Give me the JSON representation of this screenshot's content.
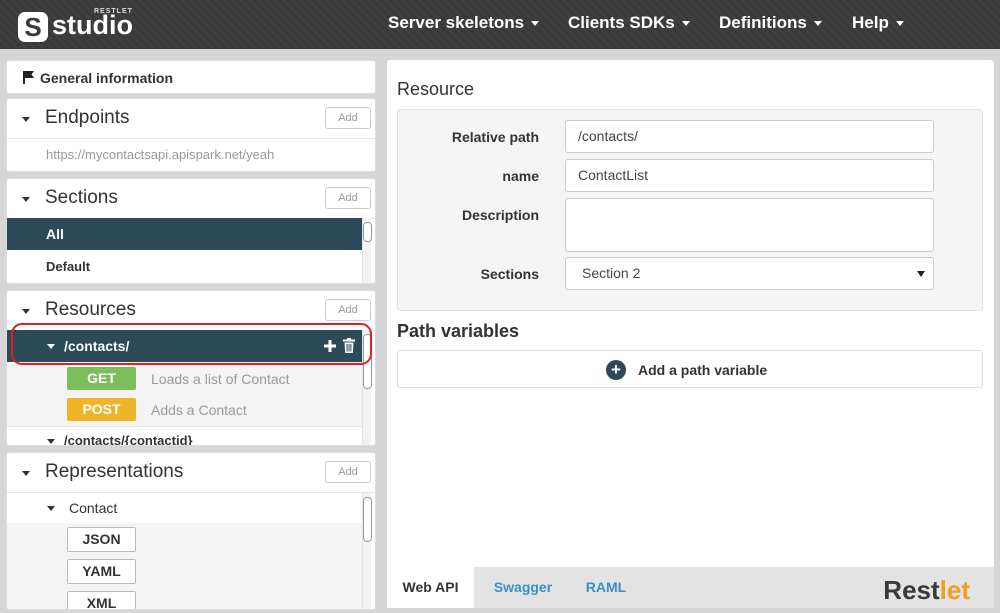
{
  "header": {
    "logo_small": "RESTLET",
    "logo_text": "studio",
    "nav": [
      {
        "label": "Server skeletons"
      },
      {
        "label": "Clients SDKs"
      },
      {
        "label": "Definitions"
      },
      {
        "label": "Help"
      }
    ]
  },
  "sidebar": {
    "general": {
      "label": "General information",
      "icon": "flag-icon"
    },
    "endpoints": {
      "title": "Endpoints",
      "add_label": "Add",
      "url": "https://mycontactsapi.apispark.net/yeah"
    },
    "sections": {
      "title": "Sections",
      "add_label": "Add",
      "items": [
        {
          "label": "All"
        },
        {
          "label": "Default"
        }
      ]
    },
    "resources": {
      "title": "Resources",
      "add_label": "Add",
      "items": [
        {
          "path": "/contacts/",
          "methods": [
            {
              "verb": "GET",
              "description": "Loads a list of Contact",
              "color": "#7cbf5a"
            },
            {
              "verb": "POST",
              "description": "Adds a Contact",
              "color": "#f0b429"
            }
          ]
        },
        {
          "path": "/contacts/{contactid}"
        }
      ]
    },
    "representations": {
      "title": "Representations",
      "add_label": "Add",
      "items": [
        {
          "name": "Contact",
          "formats": [
            "JSON",
            "YAML",
            "XML"
          ]
        }
      ]
    }
  },
  "main": {
    "title": "Resource",
    "fields": {
      "relative_path": {
        "label": "Relative path",
        "value": "/contacts/"
      },
      "name": {
        "label": "name",
        "value": "ContactList"
      },
      "description": {
        "label": "Description",
        "value": ""
      },
      "sections": {
        "label": "Sections",
        "value": "Section 2"
      }
    },
    "path_variables": {
      "title": "Path variables",
      "add_label": "Add a path variable"
    },
    "tabs": [
      {
        "label": "Web API"
      },
      {
        "label": "Swagger"
      },
      {
        "label": "RAML"
      }
    ],
    "brand": {
      "part1": "Rest",
      "part2": "let"
    }
  },
  "colors": {
    "selected_row": "#2c4a58",
    "get": "#7cbf5a",
    "post": "#f0b429",
    "tab_link": "#3a8fc4",
    "highlight_ring": "#e02020"
  }
}
